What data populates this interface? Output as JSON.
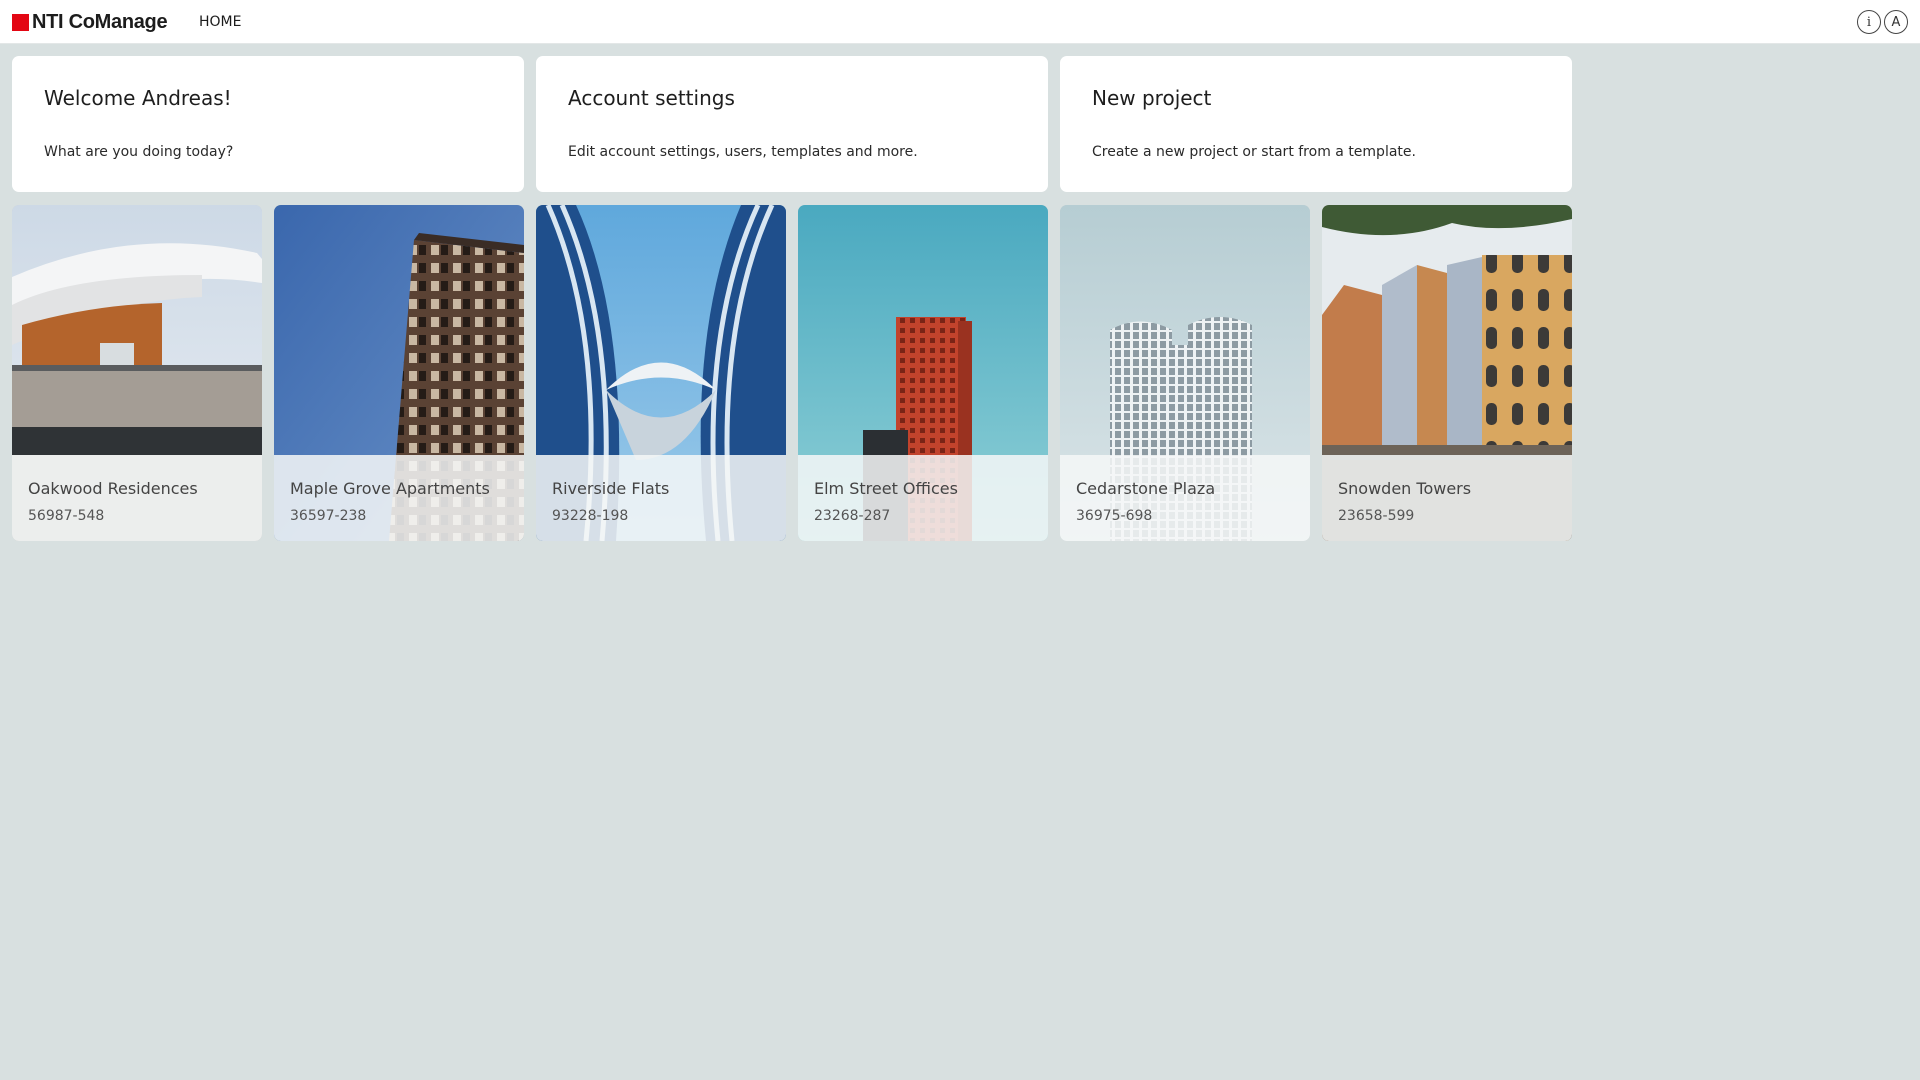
{
  "app": {
    "name": "NTI CoManage",
    "logo_icon": "nti-logo-icon",
    "brand_color": "#e30613"
  },
  "nav": {
    "home": "HOME"
  },
  "header_icons": {
    "info": {
      "icon": "info-icon",
      "glyph": "i"
    },
    "account": {
      "icon": "account-avatar-icon",
      "glyph": "A"
    }
  },
  "cards": [
    {
      "title": "Welcome Andreas!",
      "description": "What are you doing today?"
    },
    {
      "title": "Account settings",
      "description": "Edit account settings, users, templates and more."
    },
    {
      "title": "New project",
      "description": "Create a new project or start from a template."
    }
  ],
  "projects": [
    {
      "name": "Oakwood Residences",
      "id": "56987-548"
    },
    {
      "name": "Maple Grove Apartments",
      "id": "36597-238"
    },
    {
      "name": "Riverside Flats",
      "id": "93228-198"
    },
    {
      "name": "Elm Street Offices",
      "id": "23268-287"
    },
    {
      "name": "Cedarstone Plaza",
      "id": "36975-698"
    },
    {
      "name": "Snowden Towers",
      "id": "23658-599"
    }
  ],
  "colors": {
    "page_background": "#d8e0e0",
    "card_background": "#ffffff"
  }
}
